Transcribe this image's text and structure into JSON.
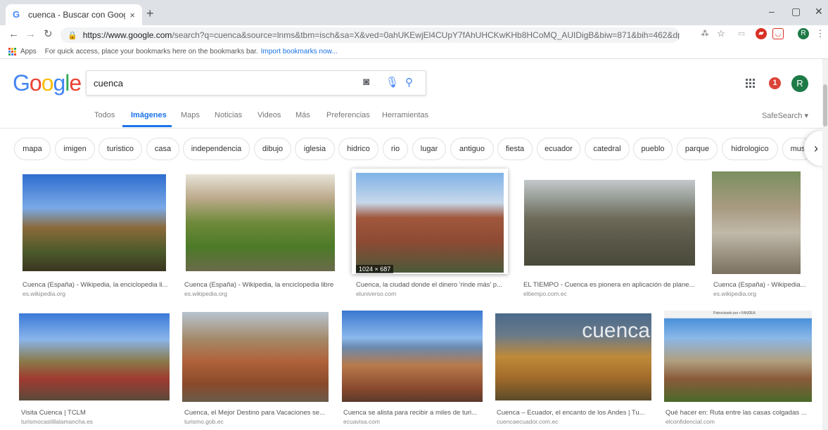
{
  "browser": {
    "tab_title": "cuenca - Buscar con Google",
    "tab_favicon": "G",
    "tab_close": "×",
    "new_tab": "+",
    "url_host": "https://www.google.com",
    "url_rest": "/search?q=cuenca&source=lnms&tbm=isch&sa=X&ved=0ahUKEwjEl4CUpY7fAhUHCKwKHb8HCoMQ_AUIDigB&biw=871&bih=462&dpr=1.25",
    "bookmarks_apps": "Apps",
    "bookmarks_hint": "For quick access, place your bookmarks here on the bookmarks bar.",
    "bookmarks_import": "Import bookmarks now...",
    "minimize": "–",
    "maximize": "▢",
    "close": "✕"
  },
  "google": {
    "logo_letters": [
      "G",
      "o",
      "o",
      "g",
      "l",
      "e"
    ],
    "logo_colors": [
      "#4285f4",
      "#ea4335",
      "#fbbc05",
      "#4285f4",
      "#34a853",
      "#ea4335"
    ],
    "query": "cuenca",
    "notifications": "1",
    "avatar_initial": "R"
  },
  "nav_tabs": [
    "Todos",
    "Imágenes",
    "Maps",
    "Noticias",
    "Videos",
    "Más",
    "Preferencias",
    "Herramientas"
  ],
  "active_tab": "Imágenes",
  "safesearch": "SafeSearch ▾",
  "chips": [
    "mapa",
    "imigen",
    "turistico",
    "casa",
    "independencia",
    "dibujo",
    "iglesia",
    "hidrico",
    "rio",
    "lugar",
    "antiguo",
    "fiesta",
    "ecuador",
    "catedral",
    "pueblo",
    "parque",
    "hidrologico",
    "mus"
  ],
  "results": [
    {
      "title": "Cuenca (España) - Wikipedia, la enciclopedia li...",
      "source": "es.wikipedia.org"
    },
    {
      "title": "Cuenca (España) - Wikipedia, la enciclopedia libre",
      "source": "es.wikipedia.org"
    },
    {
      "title": "Cuenca, la ciudad donde el dinero 'rinde más' p...",
      "source": "eluniverso.com"
    },
    {
      "title": "EL TIEMPO - Cuenca es pionera en aplicación de plane...",
      "source": "eltiempo.com.ec"
    },
    {
      "title": "Cuenca (España) - Wikipedia...",
      "source": "es.wikipedia.org"
    },
    {
      "title": "Visita Cuenca | TCLM",
      "source": "turismocastillalamancha.es"
    },
    {
      "title": "Cuenca, el Mejor Destino para Vacaciones se...",
      "source": "turismo.gob.ec"
    },
    {
      "title": "Cuenca se alista para recibir a miles de turi...",
      "source": "ecuavisa.com"
    },
    {
      "title": "Cuenca – Ecuador, el encanto de los Andes | Tu...",
      "source": "cuencaecuador.com.ec"
    },
    {
      "title": "Qué hacer en: Ruta entre las casas colgadas ...",
      "source": "elconfidencial.com"
    }
  ],
  "selected_dims": "1024 × 687",
  "thumb4_overlay": "cuenca",
  "thumb10_banner": "Patrocinado por ▪ FANDEA"
}
